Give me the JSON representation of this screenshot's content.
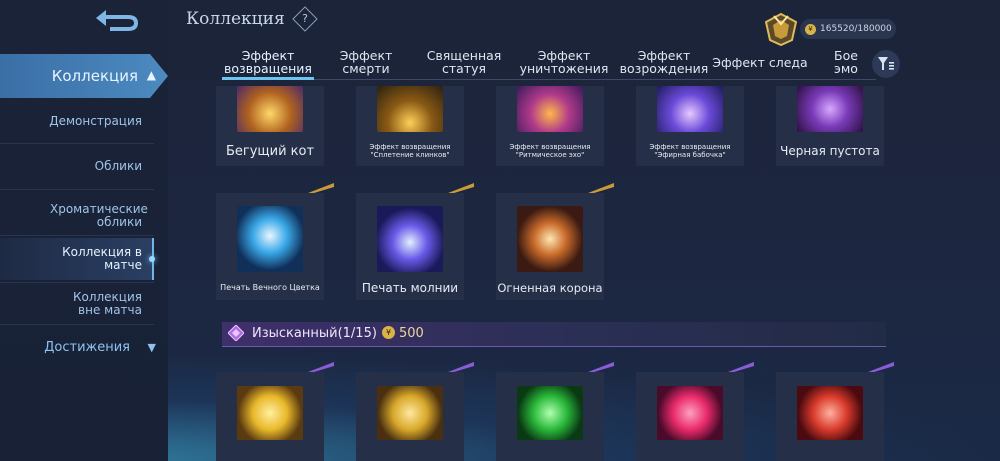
{
  "header": {
    "title": "Коллекция",
    "help_icon": "?",
    "points": "165520/180000",
    "coin_symbol": "¥"
  },
  "sidebar": {
    "main": "Коллекция",
    "items": [
      {
        "label": "Демонстрация"
      },
      {
        "label": "Облики"
      },
      {
        "label": "Хроматические облики"
      },
      {
        "label": "Коллекция в матче",
        "active": true
      },
      {
        "label": "Коллекция вне матча"
      }
    ],
    "achievements": "Достижения"
  },
  "tabs": [
    {
      "label": "Эффект возвращения",
      "active": true
    },
    {
      "label": "Эффект смерти"
    },
    {
      "label": "Священная статуя"
    },
    {
      "label": "Эффект уничтожения"
    },
    {
      "label": "Эффект возрождения"
    },
    {
      "label": "Эффект следа"
    },
    {
      "label": "Бое эмо"
    }
  ],
  "row1": [
    {
      "label": "Бегущий кот"
    },
    {
      "label": "Эффект возвращения \"Сплетение клинков\""
    },
    {
      "label": "Эффект возвращения \"Ритмическое эхо\""
    },
    {
      "label": "Эффект возвращения \"Эфирная бабочка\""
    },
    {
      "label": "Черная пустота"
    }
  ],
  "row2": [
    {
      "label": "Печать Вечного Цветка"
    },
    {
      "label": "Печать молнии"
    },
    {
      "label": "Огненная корона"
    }
  ],
  "section": {
    "name": "Изысканный(1/15)",
    "price": "500"
  },
  "colors": {
    "accent": "#6fc3ef",
    "gold": "#d9b24a",
    "purple": "#8a5cd8"
  }
}
